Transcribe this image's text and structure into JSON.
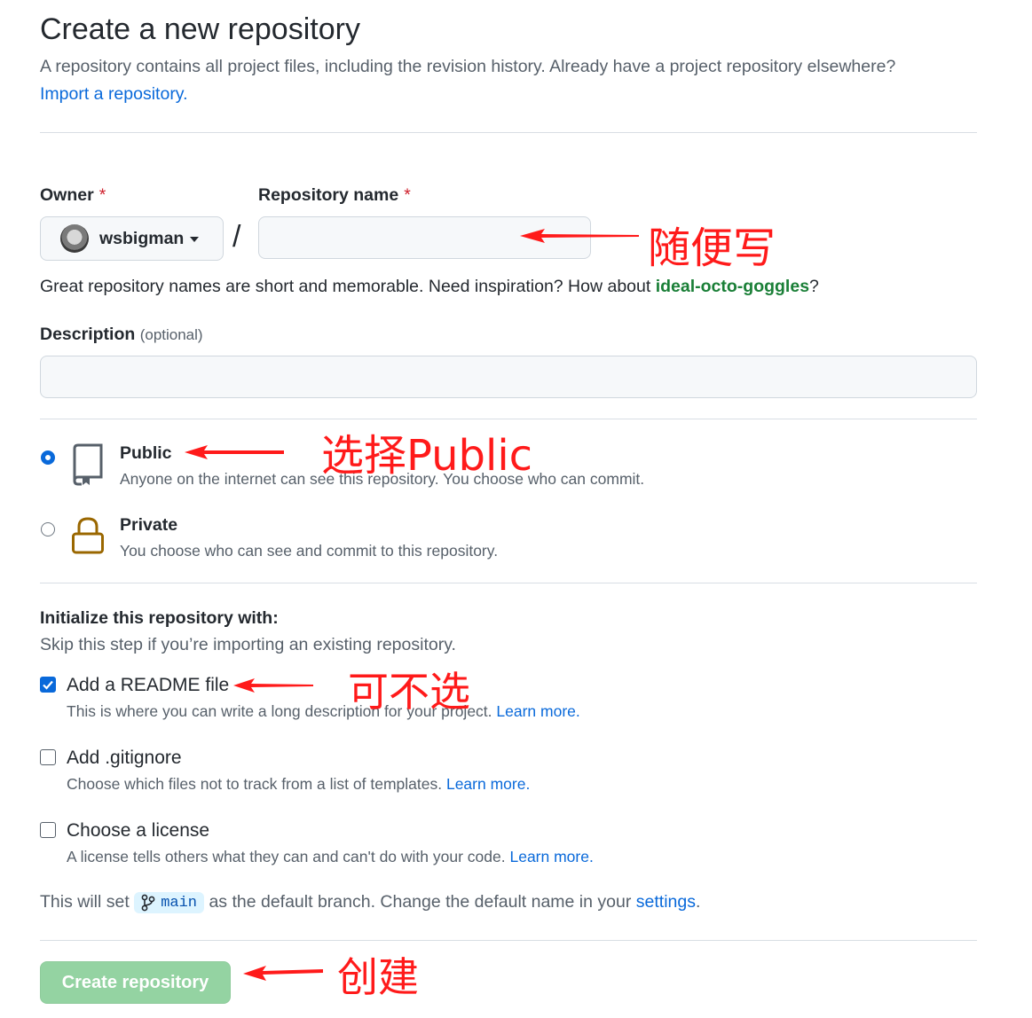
{
  "header": {
    "title": "Create a new repository",
    "subtitle": "A repository contains all project files, including the revision history. Already have a project repository elsewhere?",
    "import_link": "Import a repository."
  },
  "form": {
    "owner_label": "Owner",
    "owner_value": "wsbigman",
    "repo_label": "Repository name",
    "required_mark": "*",
    "separator": "/",
    "repo_value": "",
    "name_hint_prefix": "Great repository names are short and memorable. Need inspiration? How about ",
    "name_suggestion": "ideal-octo-goggles",
    "name_hint_suffix": "?",
    "description_label": "Description",
    "description_optional": "(optional)",
    "description_value": ""
  },
  "visibility": {
    "public": {
      "title": "Public",
      "description": "Anyone on the internet can see this repository. You choose who can commit.",
      "checked": true
    },
    "private": {
      "title": "Private",
      "description": "You choose who can see and commit to this repository.",
      "checked": false
    }
  },
  "initialize": {
    "heading": "Initialize this repository with:",
    "subheading": "Skip this step if you’re importing an existing repository.",
    "readme": {
      "label": "Add a README file",
      "description": "This is where you can write a long description for your project.",
      "link": "Learn more.",
      "checked": true
    },
    "gitignore": {
      "label": "Add .gitignore",
      "description": "Choose which files not to track from a list of templates.",
      "link": "Learn more.",
      "checked": false
    },
    "license": {
      "label": "Choose a license",
      "description": "A license tells others what they can and can't do with your code.",
      "link": "Learn more.",
      "checked": false
    }
  },
  "branch_note": {
    "prefix": "This will set",
    "branch": "main",
    "middle": "as the default branch. Change the default name in your",
    "link": "settings",
    "suffix": "."
  },
  "submit": {
    "label": "Create repository"
  },
  "annotations": {
    "repo_name": "随便写",
    "public": "选择Public",
    "readme": "可不选",
    "create": "创建"
  },
  "colors": {
    "link": "#0969da",
    "required": "#cf222e",
    "suggestion": "#1a7f37",
    "button_disabled": "#94d3a2",
    "annotation": "#ff1a1a"
  },
  "icons": [
    "repo-icon",
    "lock-icon",
    "git-branch-icon",
    "caret-down-icon",
    "check-icon",
    "arrow-left-icon"
  ]
}
